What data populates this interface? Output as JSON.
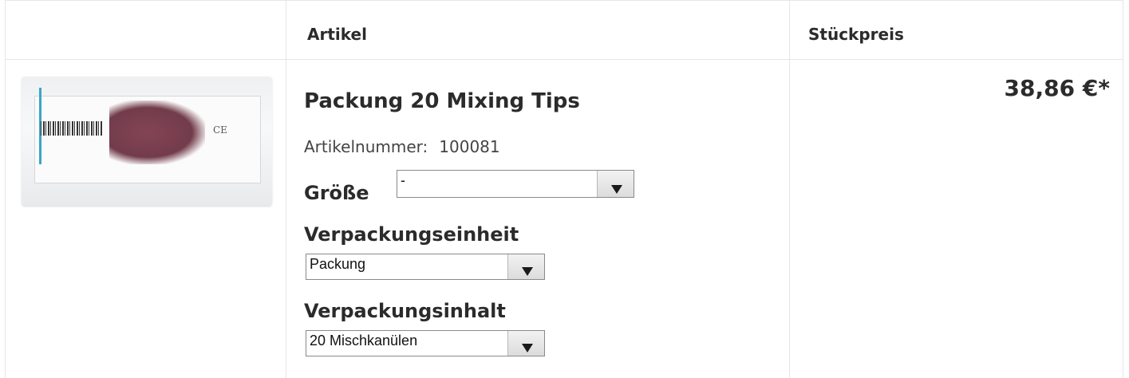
{
  "table": {
    "header": {
      "article": "Artikel",
      "unit_price": "Stückpreis"
    }
  },
  "product": {
    "name": "Packung 20 Mixing Tips",
    "article_number_label": "Artikelnummer:",
    "article_number": "100081",
    "price": "38,86 €*",
    "image_icon": "product-package-image"
  },
  "options": {
    "size": {
      "label": "Größe",
      "value": "-"
    },
    "packaging_unit": {
      "label": "Verpackungseinheit",
      "value": "Packung"
    },
    "packaging_content": {
      "label": "Verpackungsinhalt",
      "value": "20 Mischkanülen"
    }
  },
  "colors": {
    "border": "#e6e6e6",
    "text": "#2b2b2b"
  }
}
